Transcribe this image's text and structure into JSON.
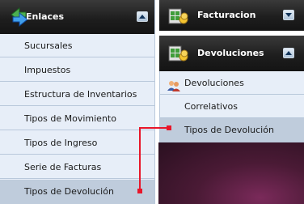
{
  "left_panel": {
    "title": "Enlaces",
    "icon": "arrows-icon",
    "items": [
      {
        "label": "Sucursales"
      },
      {
        "label": "Impuestos"
      },
      {
        "label": "Estructura de Inventarios"
      },
      {
        "label": "Tipos de Movimiento"
      },
      {
        "label": "Tipos de Ingreso"
      },
      {
        "label": "Serie de Facturas"
      },
      {
        "label": "Tipos de Devolución",
        "selected": true
      }
    ]
  },
  "right_panels": [
    {
      "title": "Facturacion",
      "icon": "invoice-icon"
    },
    {
      "title": "Devoluciones",
      "icon": "returns-icon",
      "items": [
        {
          "label": "Devoluciones",
          "icon": "users-icon"
        },
        {
          "label": "Correlativos"
        },
        {
          "label": "Tipos de Devolución",
          "selected": true
        }
      ]
    }
  ],
  "colors": {
    "header_bg": "#1e1e1e",
    "item_bg": "#e7eef8",
    "selected_bg": "#bfccdc",
    "callout": "#e8162a",
    "desktop_bg": "#5a1f3d"
  }
}
